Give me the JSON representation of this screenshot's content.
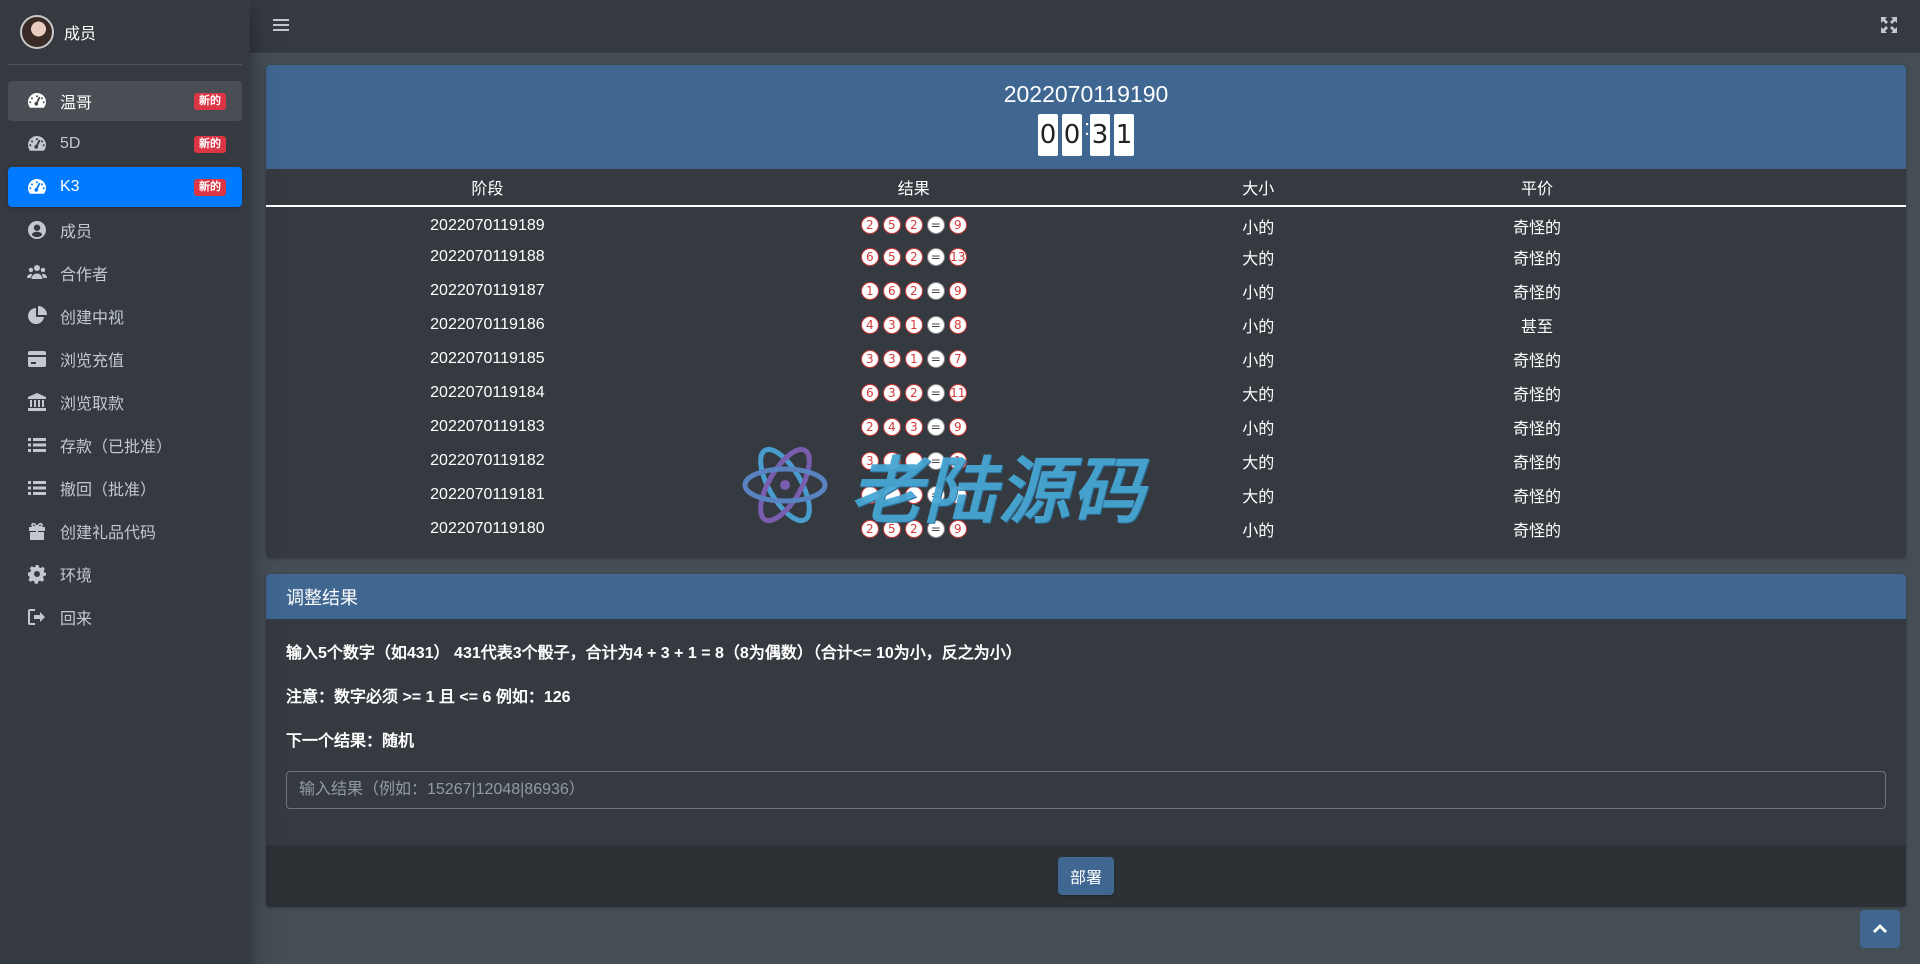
{
  "sidebar": {
    "user_name": "成员",
    "items": [
      {
        "label": "温哥",
        "badge": "新的",
        "icon": "tachometer-icon",
        "state": "open"
      },
      {
        "label": "5D",
        "badge": "新的",
        "icon": "tachometer-icon",
        "state": ""
      },
      {
        "label": "K3",
        "badge": "新的",
        "icon": "tachometer-icon",
        "state": "active"
      },
      {
        "label": "成员",
        "icon": "user-circle-icon"
      },
      {
        "label": "合作者",
        "icon": "users-icon"
      },
      {
        "label": "创建中视",
        "icon": "pie-chart-icon"
      },
      {
        "label": "浏览充值",
        "icon": "credit-card-icon"
      },
      {
        "label": "浏览取款",
        "icon": "bank-icon"
      },
      {
        "label": "存款（已批准）",
        "icon": "list-icon"
      },
      {
        "label": "撤回（批准）",
        "icon": "list-icon"
      },
      {
        "label": "创建礼品代码",
        "icon": "gift-icon"
      },
      {
        "label": "环境",
        "icon": "gear-icon"
      },
      {
        "label": "回来",
        "icon": "sign-out-icon"
      }
    ]
  },
  "game": {
    "period": "2022070119190",
    "countdown": [
      "0",
      "0",
      "3",
      "1"
    ]
  },
  "table": {
    "headers": [
      "阶段",
      "结果",
      "大小",
      "平价"
    ],
    "rows": [
      {
        "period": "2022070119189",
        "dice": [
          "2",
          "5",
          "2"
        ],
        "sum": "9",
        "size": "小的",
        "parity": "奇怪的"
      },
      {
        "period": "2022070119188",
        "dice": [
          "6",
          "5",
          "2"
        ],
        "sum": "13",
        "size": "大的",
        "parity": "奇怪的"
      },
      {
        "period": "2022070119187",
        "dice": [
          "1",
          "6",
          "2"
        ],
        "sum": "9",
        "size": "小的",
        "parity": "奇怪的"
      },
      {
        "period": "2022070119186",
        "dice": [
          "4",
          "3",
          "1"
        ],
        "sum": "8",
        "size": "小的",
        "parity": "甚至"
      },
      {
        "period": "2022070119185",
        "dice": [
          "3",
          "3",
          "1"
        ],
        "sum": "7",
        "size": "小的",
        "parity": "奇怪的"
      },
      {
        "period": "2022070119184",
        "dice": [
          "6",
          "3",
          "2"
        ],
        "sum": "11",
        "size": "大的",
        "parity": "奇怪的"
      },
      {
        "period": "2022070119183",
        "dice": [
          "2",
          "4",
          "3"
        ],
        "sum": "9",
        "size": "小的",
        "parity": "奇怪的"
      },
      {
        "period": "2022070119182",
        "dice": [
          "3",
          "",
          ""
        ],
        "sum": "1",
        "size": "大的",
        "parity": "奇怪的"
      },
      {
        "period": "2022070119181",
        "dice": [
          "",
          "",
          ""
        ],
        "sum": "",
        "size": "大的",
        "parity": "奇怪的"
      },
      {
        "period": "2022070119180",
        "dice": [
          "2",
          "5",
          "2"
        ],
        "sum": "9",
        "size": "小的",
        "parity": "奇怪的"
      }
    ],
    "equals_sign": "="
  },
  "adjust": {
    "title": "调整结果",
    "line1": "输入5个数字（如431） 431代表3个骰子，合计为4 + 3 + 1 = 8（8为偶数）（合计<= 10为小，反之为小）",
    "line2": "注意：数字必须 >= 1 且 <= 6 例如：126",
    "line3": "下一个结果：随机",
    "input_placeholder": "输入结果（例如：15267|12048|86936）",
    "input_value": "",
    "deploy_label": "部署"
  },
  "watermark": {
    "text": "老陆源码"
  },
  "colors": {
    "accent": "#3f6791",
    "active": "#007bff",
    "badge": "#dc3545",
    "sidebar": "#343a40",
    "background": "#454d55"
  }
}
